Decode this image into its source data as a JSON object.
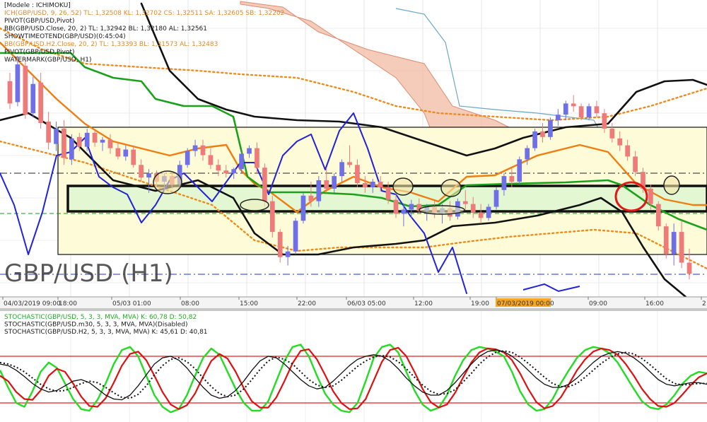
{
  "main_panel": {
    "legend": [
      {
        "text": "[Modele : ICHIMOKU]",
        "color": "#1a1a1a"
      },
      {
        "text": "ICH(GBP/USD, 9, 26, 52)  TL: 1,32508  KL: 1,32702  CS: 1,32511  SA: 1,32605  SB: 1,32202",
        "color": "#e08a2a"
      },
      {
        "text": "PIVOT(GBP/USD,Pivot)",
        "color": "#1a1a1a"
      },
      {
        "text": "BB(GBP/USD.Close, 20, 2)  TL: 1,32942  BL: 1,32180  AL: 1,32561",
        "color": "#1a1a1a"
      },
      {
        "text": "SHOWTIMEOTEND(GBP/USD)(0:45:04)",
        "color": "#1a1a1a"
      },
      {
        "text": "BB(GBP/USD.H2.Close, 20, 2)  TL: 1,33393  BL: 1,31573  AL: 1,32483",
        "color": "#e08a2a"
      },
      {
        "text": "PIVOT(GBP/USD,Pivot)",
        "color": "#1a1a1a"
      },
      {
        "text": "WATERMARK(GBP/USD, H1)",
        "color": "#1a1a1a"
      }
    ],
    "watermark": "GBP/USD (H1)"
  },
  "time_axis": {
    "labels": [
      "04/03/2019 09:00",
      "18:00",
      "05/03 01:00",
      "08:00",
      "15:00",
      "22:00",
      "06/03 05:00",
      "12:00",
      "19:00",
      "07/03/2019 00:00",
      "09:00",
      "16:00",
      "2"
    ],
    "highlight_label": "07/03/2019 00:00"
  },
  "stoch_panel": {
    "legend": [
      {
        "text": "STOCHASTIC(GBP/USD, 5, 3, 3, MVA, MVA)  K: 60,78  D: 50,82",
        "color": "#22aa22"
      },
      {
        "text": "STOCHASTIC(GBP/USD.m30, 5, 3, 3, MVA, MVA)(Disabled)",
        "color": "#1a1a1a"
      },
      {
        "text": "STOCHASTIC(GBP/USD.H2, 5, 3, 3, MVA, MVA)  K: 45,61  D: 40,81",
        "color": "#1a1a1a"
      }
    ]
  },
  "colors": {
    "bull_candle": "#6f6fe8",
    "bear_candle": "#ef7a7a",
    "kijun": "#1aa11a",
    "tenkan": "#f07d10",
    "chikou": "#2222dd",
    "bollinger": "#111111",
    "bollinger_h2": "#ef8a1a",
    "stoch_k": "#22dd22",
    "stoch_d": "#dd1111",
    "stoch_h2": "#111111",
    "time_highlight": "#f5a623"
  },
  "chart_data": [
    {
      "type": "candlestick",
      "title": "GBP/USD (H1)",
      "candles": [
        [
          1.3312,
          1.3318,
          1.3292,
          1.3296
        ],
        [
          1.3297,
          1.333,
          1.3294,
          1.3324
        ],
        [
          1.3323,
          1.3328,
          1.3285,
          1.3288
        ],
        [
          1.3289,
          1.3315,
          1.3286,
          1.331
        ],
        [
          1.3311,
          1.3318,
          1.3278,
          1.3282
        ],
        [
          1.3283,
          1.329,
          1.3263,
          1.3268
        ],
        [
          1.3267,
          1.3283,
          1.3262,
          1.3278
        ],
        [
          1.3278,
          1.3284,
          1.3252,
          1.3257
        ],
        [
          1.3256,
          1.3274,
          1.3252,
          1.3271
        ],
        [
          1.3272,
          1.3275,
          1.3262,
          1.3265
        ],
        [
          1.3265,
          1.3278,
          1.3262,
          1.3275
        ],
        [
          1.3275,
          1.3277,
          1.3265,
          1.3268
        ],
        [
          1.3268,
          1.3272,
          1.3262,
          1.327
        ],
        [
          1.327,
          1.3274,
          1.326,
          1.3264
        ],
        [
          1.3264,
          1.3268,
          1.3256,
          1.3258
        ],
        [
          1.3258,
          1.3266,
          1.3255,
          1.3263
        ],
        [
          1.3263,
          1.3266,
          1.325,
          1.3252
        ],
        [
          1.3252,
          1.3256,
          1.324,
          1.3243
        ],
        [
          1.3243,
          1.3249,
          1.3232,
          1.3246
        ],
        [
          1.3246,
          1.3248,
          1.3236,
          1.324
        ],
        [
          1.324,
          1.3246,
          1.3233,
          1.3244
        ],
        [
          1.3244,
          1.3247,
          1.3235,
          1.3238
        ],
        [
          1.3238,
          1.3255,
          1.3235,
          1.3252
        ],
        [
          1.3252,
          1.3264,
          1.325,
          1.3262
        ],
        [
          1.3262,
          1.327,
          1.3258,
          1.3266
        ],
        [
          1.3266,
          1.327,
          1.3255,
          1.3259
        ],
        [
          1.3259,
          1.3264,
          1.3249,
          1.3252
        ],
        [
          1.3252,
          1.3256,
          1.3244,
          1.3248
        ],
        [
          1.3248,
          1.3252,
          1.3243,
          1.3246
        ],
        [
          1.3246,
          1.325,
          1.3242,
          1.3249
        ],
        [
          1.3249,
          1.3262,
          1.3246,
          1.326
        ],
        [
          1.326,
          1.3266,
          1.3257,
          1.3264
        ],
        [
          1.3264,
          1.3268,
          1.3246,
          1.325
        ],
        [
          1.325,
          1.3253,
          1.3222,
          1.3226
        ],
        [
          1.3226,
          1.323,
          1.32,
          1.3204
        ],
        [
          1.3204,
          1.3206,
          1.3182,
          1.3186
        ],
        [
          1.3186,
          1.3194,
          1.318,
          1.319
        ],
        [
          1.319,
          1.3214,
          1.3188,
          1.3212
        ],
        [
          1.3212,
          1.3232,
          1.321,
          1.323
        ],
        [
          1.323,
          1.324,
          1.3222,
          1.3226
        ],
        [
          1.3226,
          1.3244,
          1.3222,
          1.3241
        ],
        [
          1.3241,
          1.325,
          1.3232,
          1.3235
        ],
        [
          1.3235,
          1.3246,
          1.3232,
          1.3244
        ],
        [
          1.3244,
          1.3256,
          1.324,
          1.3254
        ],
        [
          1.3254,
          1.3266,
          1.325,
          1.3252
        ],
        [
          1.3252,
          1.3256,
          1.3236,
          1.3239
        ],
        [
          1.3239,
          1.3244,
          1.3232,
          1.3236
        ],
        [
          1.3236,
          1.3242,
          1.3232,
          1.324
        ],
        [
          1.324,
          1.3244,
          1.3233,
          1.3236
        ],
        [
          1.3236,
          1.324,
          1.3224,
          1.3227
        ],
        [
          1.3227,
          1.3231,
          1.3214,
          1.3217
        ],
        [
          1.3217,
          1.3224,
          1.3208,
          1.322
        ],
        [
          1.322,
          1.3227,
          1.3214,
          1.3224
        ],
        [
          1.3224,
          1.3228,
          1.3217,
          1.3219
        ],
        [
          1.3219,
          1.3224,
          1.3212,
          1.3222
        ],
        [
          1.3222,
          1.3226,
          1.3214,
          1.3218
        ],
        [
          1.3218,
          1.3224,
          1.321,
          1.3221
        ],
        [
          1.3221,
          1.3226,
          1.3212,
          1.3215
        ],
        [
          1.3215,
          1.3228,
          1.3213,
          1.3226
        ],
        [
          1.3226,
          1.3234,
          1.322,
          1.3224
        ],
        [
          1.3224,
          1.3229,
          1.3214,
          1.3218
        ],
        [
          1.3218,
          1.3224,
          1.321,
          1.3214
        ],
        [
          1.3214,
          1.3224,
          1.3212,
          1.3222
        ],
        [
          1.3222,
          1.3236,
          1.322,
          1.3234
        ],
        [
          1.3234,
          1.3246,
          1.323,
          1.3244
        ],
        [
          1.3244,
          1.325,
          1.3236,
          1.324
        ],
        [
          1.324,
          1.3258,
          1.3238,
          1.3256
        ],
        [
          1.3256,
          1.3266,
          1.3252,
          1.3264
        ],
        [
          1.3264,
          1.3278,
          1.3262,
          1.3276
        ],
        [
          1.3276,
          1.3282,
          1.3268,
          1.3272
        ],
        [
          1.3272,
          1.3286,
          1.327,
          1.3284
        ],
        [
          1.3284,
          1.3292,
          1.328,
          1.3288
        ],
        [
          1.3288,
          1.3298,
          1.3284,
          1.3296
        ],
        [
          1.3296,
          1.3302,
          1.329,
          1.3294
        ],
        [
          1.3294,
          1.3296,
          1.3284,
          1.3286
        ],
        [
          1.3286,
          1.3296,
          1.3284,
          1.3294
        ],
        [
          1.3294,
          1.3298,
          1.3286,
          1.3289
        ],
        [
          1.3289,
          1.3292,
          1.3275,
          1.3278
        ],
        [
          1.3278,
          1.3282,
          1.3268,
          1.3271
        ],
        [
          1.3271,
          1.3276,
          1.3262,
          1.3266
        ],
        [
          1.3266,
          1.327,
          1.3255,
          1.3258
        ],
        [
          1.3258,
          1.3262,
          1.3244,
          1.3247
        ],
        [
          1.3247,
          1.325,
          1.3232,
          1.3235
        ],
        [
          1.3235,
          1.3238,
          1.322,
          1.3224
        ],
        [
          1.3224,
          1.3226,
          1.3205,
          1.3208
        ],
        [
          1.3208,
          1.321,
          1.3185,
          1.3188
        ],
        [
          1.3188,
          1.321,
          1.318,
          1.3204
        ],
        [
          1.3204,
          1.3212,
          1.3178,
          1.3182
        ],
        [
          1.3182,
          1.3192,
          1.317,
          1.3174
        ]
      ]
    },
    {
      "type": "line",
      "title": "STOCHASTIC",
      "ylim": [
        0,
        100
      ],
      "levels": [
        80,
        20
      ],
      "series": [
        {
          "name": "K",
          "values": [
            62,
            40,
            20,
            15,
            35,
            60,
            72,
            65,
            45,
            25,
            12,
            10,
            24,
            45,
            70,
            88,
            92,
            80,
            55,
            30,
            15,
            8,
            12,
            30,
            55,
            78,
            90,
            82,
            60,
            38,
            20,
            10,
            10,
            22,
            48,
            74,
            92,
            95,
            80,
            55,
            32,
            18,
            10,
            8,
            20,
            48,
            78,
            92,
            95,
            85,
            60,
            36,
            18,
            10,
            14,
            30,
            55,
            75,
            88,
            92,
            90,
            86,
            80,
            60,
            35,
            18,
            10,
            12,
            25,
            45,
            62,
            78,
            88,
            92,
            90,
            84,
            72,
            55,
            38,
            22,
            14,
            12,
            18,
            30,
            45,
            55,
            60,
            58
          ]
        },
        {
          "name": "D",
          "values": [
            55,
            48,
            34,
            25,
            24,
            36,
            55,
            64,
            60,
            45,
            28,
            16,
            15,
            26,
            46,
            68,
            83,
            86,
            75,
            55,
            34,
            18,
            12,
            17,
            32,
            54,
            74,
            83,
            77,
            60,
            39,
            22,
            14,
            14,
            27,
            48,
            71,
            87,
            89,
            76,
            56,
            35,
            20,
            12,
            13,
            25,
            49,
            73,
            88,
            91,
            80,
            60,
            38,
            21,
            14,
            18,
            33,
            53,
            72,
            85,
            90,
            89,
            85,
            75,
            58,
            38,
            21,
            13,
            16,
            27,
            44,
            62,
            76,
            86,
            90,
            88,
            82,
            70,
            55,
            38,
            25,
            16,
            15,
            20,
            31,
            43,
            53,
            58
          ]
        },
        {
          "name": "H2 K",
          "values": [
            70,
            68,
            62,
            54,
            45,
            38,
            34,
            36,
            42,
            48,
            50,
            46,
            38,
            30,
            25,
            24,
            30,
            42,
            56,
            70,
            78,
            80,
            75,
            65,
            52,
            40,
            30,
            26,
            28,
            36,
            48,
            62,
            74,
            80,
            78,
            70,
            60,
            50,
            42,
            38,
            40,
            48,
            58,
            68,
            76,
            80,
            82,
            80,
            74,
            64,
            52,
            42,
            34,
            30,
            30,
            36,
            46,
            58,
            70,
            80,
            86,
            88,
            86,
            80,
            72,
            62,
            52,
            44,
            40,
            40,
            44,
            52,
            62,
            72,
            80,
            84,
            86,
            84,
            78,
            70,
            60,
            50,
            44,
            42,
            44,
            46,
            46,
            44
          ]
        },
        {
          "name": "H2 D",
          "values": [
            72,
            70,
            66,
            60,
            52,
            44,
            38,
            35,
            36,
            40,
            45,
            48,
            46,
            40,
            33,
            27,
            26,
            31,
            42,
            56,
            68,
            76,
            78,
            73,
            64,
            52,
            41,
            32,
            28,
            30,
            38,
            50,
            63,
            74,
            79,
            76,
            70,
            60,
            50,
            43,
            40,
            42,
            49,
            58,
            67,
            74,
            79,
            81,
            79,
            73,
            64,
            53,
            43,
            35,
            31,
            32,
            37,
            47,
            58,
            70,
            79,
            85,
            87,
            85,
            79,
            71,
            62,
            53,
            45,
            41,
            41,
            45,
            53,
            62,
            71,
            78,
            83,
            85,
            83,
            77,
            69,
            60,
            51,
            45,
            43,
            44,
            45,
            45
          ]
        }
      ]
    }
  ]
}
